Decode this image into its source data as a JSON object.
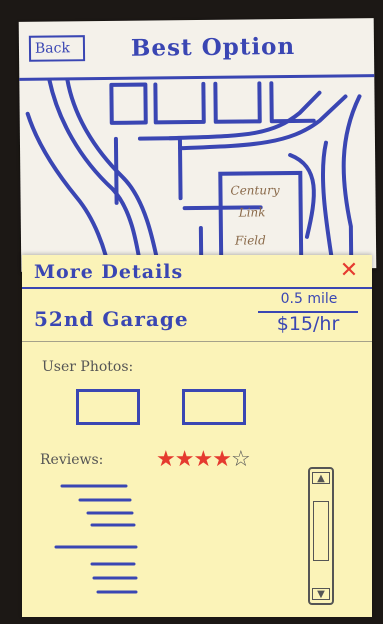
{
  "map_screen": {
    "back_label": "Back",
    "title": "Best Option",
    "map": {
      "landmark_line1": "Century",
      "landmark_line2": "Link",
      "landmark_line3": "Field"
    }
  },
  "details": {
    "title": "More Details",
    "close_icon": "close-icon",
    "garage_name": "52nd Garage",
    "distance": "0.5 mile",
    "price": "$15/hr",
    "photos_label": "User Photos:",
    "reviews_label": "Reviews:",
    "rating": 4,
    "rating_max": 5,
    "star_on": "★",
    "star_off": "☆"
  },
  "colors": {
    "ink": "#3a46b3",
    "accent_red": "#e53a2f",
    "note_yellow": "#fbf3b8",
    "paper": "#f4f1ea"
  }
}
